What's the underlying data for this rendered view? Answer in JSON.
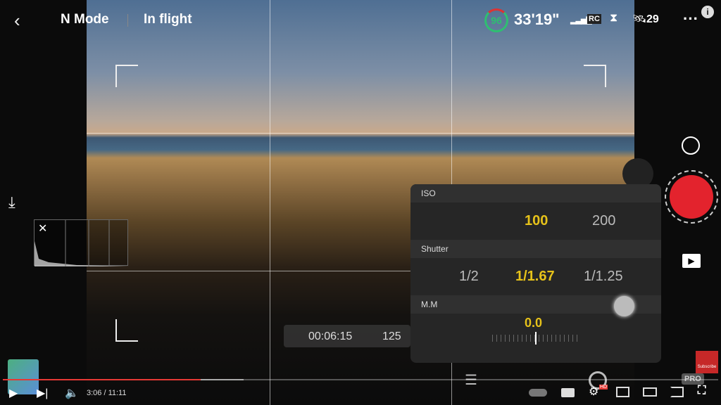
{
  "header": {
    "mode": "N Mode",
    "status": "In flight",
    "battery_percent": "96",
    "flight_time": "33'19\"",
    "rc_label": "RC",
    "satellites": "29"
  },
  "camera_panel": {
    "iso": {
      "label": "ISO",
      "options": [
        "100",
        "200"
      ],
      "selected": "100"
    },
    "shutter": {
      "label": "Shutter",
      "options": [
        "1/2",
        "1/1.67",
        "1/1.25"
      ],
      "selected": "1/1.67"
    },
    "mm": {
      "label": "M.M",
      "value": "0.0"
    }
  },
  "recording": {
    "time": "00:06:15",
    "frames": "125"
  },
  "pro_label": "PRO",
  "youtube": {
    "time": "3:06 / 11:11",
    "progress_percent": 27.7,
    "buffered_percent": 33.7,
    "subscribe_label": "Subscribe",
    "hd_badge": "HD",
    "accent": "#e53935"
  }
}
